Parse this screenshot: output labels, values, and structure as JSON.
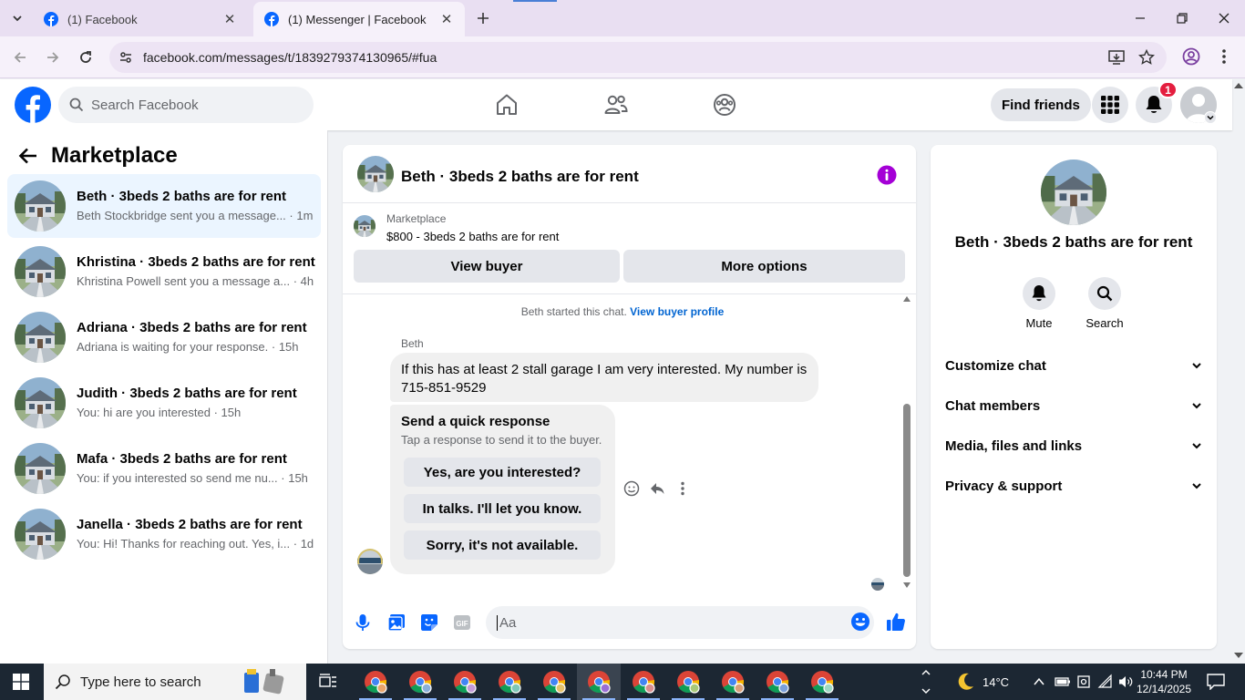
{
  "browser": {
    "tabs": [
      {
        "title": "(1) Facebook",
        "active": false
      },
      {
        "title": "(1) Messenger | Facebook",
        "active": true
      }
    ],
    "url": "facebook.com/messages/t/1839279374130965/#fua"
  },
  "header": {
    "search_placeholder": "Search Facebook",
    "find_friends_label": "Find friends",
    "notification_count": "1",
    "brand_color": "#0866ff"
  },
  "sidebar": {
    "title": "Marketplace",
    "conversations": [
      {
        "name": "Beth · 3beds 2 baths are for rent",
        "snippet": "Beth Stockbridge sent you a message... · 1m",
        "selected": true
      },
      {
        "name": "Khristina · 3beds 2 baths are for rent",
        "snippet": "Khristina Powell sent you a message a... · 4h",
        "selected": false
      },
      {
        "name": "Adriana · 3beds 2 baths are for rent",
        "snippet": "Adriana is waiting for your response. · 15h",
        "selected": false
      },
      {
        "name": "Judith · 3beds 2 baths are for rent",
        "snippet": "You: hi are you interested · 15h",
        "selected": false
      },
      {
        "name": "Mafa · 3beds 2 baths are for rent",
        "snippet": "You: if you interested so send me nu... · 15h",
        "selected": false
      },
      {
        "name": "Janella · 3beds 2 baths are for rent",
        "snippet": "You: Hi! Thanks for reaching out. Yes, i... · 1d",
        "selected": false
      }
    ]
  },
  "chat": {
    "title": "Beth · 3beds 2 baths are for rent",
    "marketplace_label": "Marketplace",
    "listing": "$800 - 3beds 2 baths are for rent",
    "view_buyer_label": "View buyer",
    "more_options_label": "More options",
    "started_text": "Beth started this chat.",
    "view_buyer_profile_label": "View buyer profile",
    "sender_name": "Beth",
    "message": "If this has at least 2 stall garage I am very interested. My number is 715-851-9529",
    "quick_title": "Send a quick response",
    "quick_subtitle": "Tap a response to send it to the buyer.",
    "quick_responses": [
      "Yes, are you interested?",
      "In talks. I'll let you know.",
      "Sorry, it's not available."
    ],
    "composer_placeholder": "Aa"
  },
  "info": {
    "title": "Beth · 3beds 2 baths are for rent",
    "actions": [
      {
        "label": "Mute"
      },
      {
        "label": "Search"
      }
    ],
    "sections": [
      "Customize chat",
      "Chat members",
      "Media, files and links",
      "Privacy & support"
    ]
  },
  "taskbar": {
    "search_placeholder": "Type here to search",
    "temperature": "14°C",
    "time": "10:44 PM",
    "date": "12/14/2025"
  }
}
